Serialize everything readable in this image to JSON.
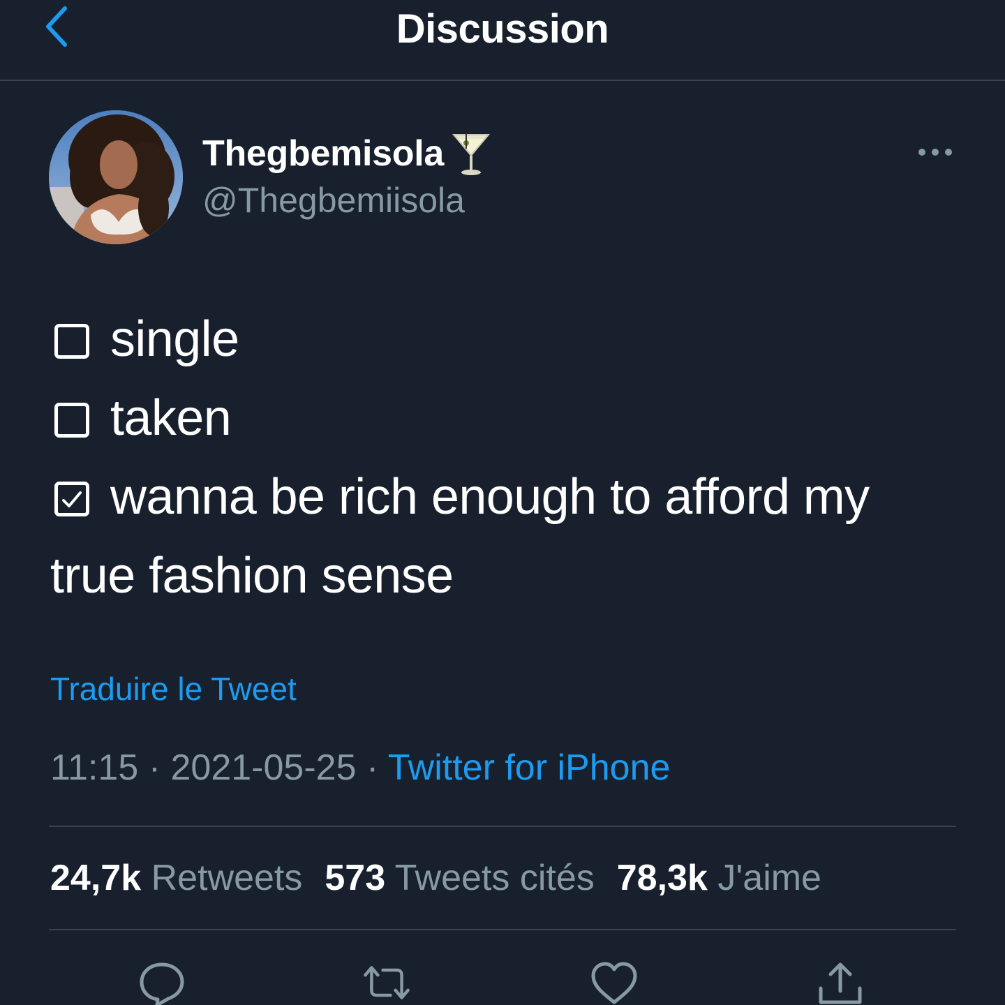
{
  "header": {
    "title": "Discussion",
    "back_icon": "chevron-left-icon"
  },
  "author": {
    "name": "Thegbemisola",
    "emoji": "cocktail-glass",
    "handle": "@Thegbemiisola"
  },
  "tweet": {
    "items": [
      {
        "checked": false,
        "text": "single"
      },
      {
        "checked": false,
        "text": "taken"
      },
      {
        "checked": true,
        "text": "wanna be rich enough to afford my"
      }
    ],
    "continuation": "true fashion sense"
  },
  "translate_label": "Traduire le Tweet",
  "meta": {
    "time": "11:15",
    "separator": " · ",
    "date": "2021-05-25",
    "source": "Twitter for iPhone"
  },
  "stats": {
    "retweets_count": "24,7k",
    "retweets_label": "Retweets",
    "quotes_count": "573",
    "quotes_label": "Tweets cités",
    "likes_count": "78,3k",
    "likes_label": "J'aime"
  },
  "colors": {
    "background": "#17202c",
    "accent": "#1d9bf0",
    "secondary_text": "#8899a6",
    "divider": "#3a444f"
  }
}
